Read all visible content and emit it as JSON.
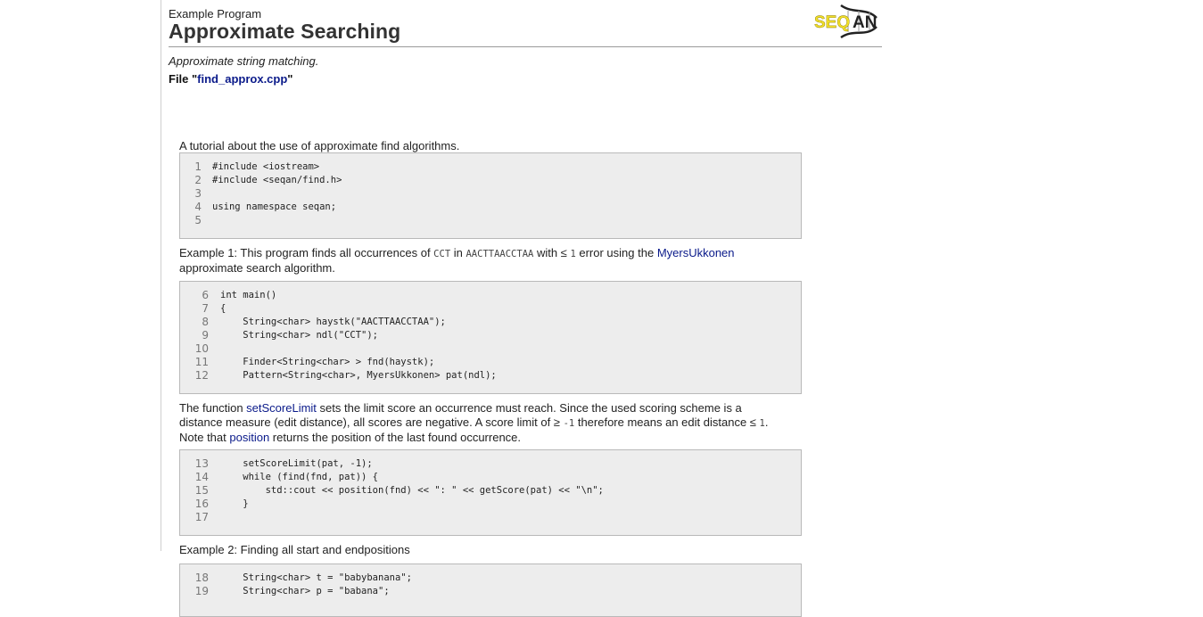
{
  "header": {
    "kicker": "Example Program",
    "title": "Approximate Searching",
    "logo_text": "SEQAN",
    "logo_colors": {
      "yellow": "#f2e02a",
      "dark": "#222222"
    }
  },
  "summary": "Approximate string matching.",
  "file": {
    "prefix": "File \"",
    "name": "find_approx.cpp",
    "suffix": "\""
  },
  "intro": "A tutorial about the use of approximate find algorithms.",
  "block1": [
    {
      "n": "1",
      "code": "#include <iostream>"
    },
    {
      "n": "2",
      "code": "#include <seqan/find.h>"
    },
    {
      "n": "3",
      "code": ""
    },
    {
      "n": "4",
      "code": "using namespace seqan;"
    },
    {
      "n": "5",
      "code": ""
    }
  ],
  "example1": {
    "t1": "Example 1: This program finds all occurrences of ",
    "c1": "CCT",
    "t2": " in ",
    "c2": "AACTTAACCTAA",
    "t3": " with ≤ ",
    "c3": "1",
    "t4": " error using the ",
    "link": "MyersUkkonen",
    "t5": "approximate search algorithm."
  },
  "block2": [
    {
      "n": "6",
      "code": "int main()"
    },
    {
      "n": "7",
      "code": "{"
    },
    {
      "n": "8",
      "code": "    String<char> haystk(\"AACTTAACCTAA\");"
    },
    {
      "n": "9",
      "code": "    String<char> ndl(\"CCT\");"
    },
    {
      "n": "10",
      "code": ""
    },
    {
      "n": "11",
      "code": "    Finder<String<char> > fnd(haystk);"
    },
    {
      "n": "12",
      "code": "    Pattern<String<char>, MyersUkkonen> pat(ndl);"
    }
  ],
  "para_score": {
    "t1": "The function ",
    "link1": "setScoreLimit",
    "t2": " sets the limit score an occurrence must reach. Since the used scoring scheme is a",
    "t3": "distance measure (edit distance), all scores are negative. A score limit of ≥ ",
    "c1": "-1",
    "t4": " therefore means an edit distance ≤ ",
    "c2": "1",
    "t5": ".",
    "t6": "Note that ",
    "link2": "position",
    "t7": " returns the position of the last found occurrence."
  },
  "block3": [
    {
      "n": "13",
      "code": "    setScoreLimit(pat, -1);"
    },
    {
      "n": "14",
      "code": "    while (find(fnd, pat)) {"
    },
    {
      "n": "15",
      "code": "        std::cout << position(fnd) << \": \" << getScore(pat) << \"\\n\";"
    },
    {
      "n": "16",
      "code": "    }"
    },
    {
      "n": "17",
      "code": ""
    }
  ],
  "example2": "Example 2: Finding all start and endpositions",
  "block4": [
    {
      "n": "18",
      "code": "    String<char> t = \"babybanana\";"
    },
    {
      "n": "19",
      "code": "    String<char> p = \"babana\";"
    }
  ]
}
